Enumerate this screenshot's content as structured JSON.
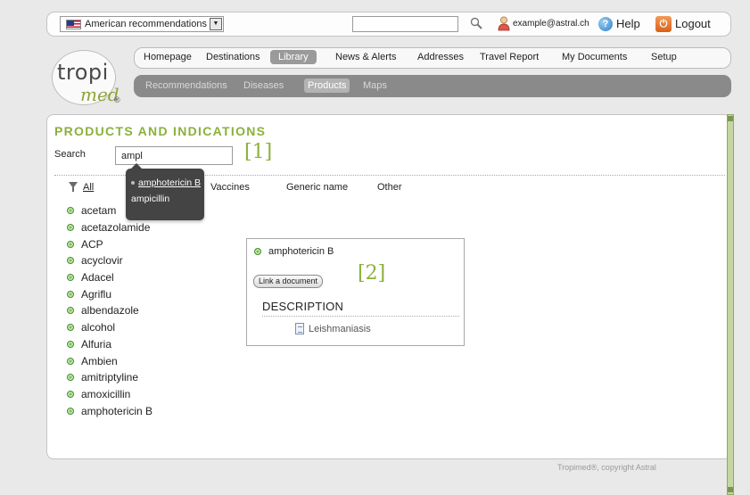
{
  "topbar": {
    "country": "American recommendations",
    "user_email": "example@astral.ch",
    "help_label": "Help",
    "logout_label": "Logout"
  },
  "logo": {
    "part1": "tropi",
    "part2": "med",
    "mark": "®"
  },
  "nav": {
    "main": [
      "Homepage",
      "Destinations",
      "Library",
      "News & Alerts",
      "Addresses",
      "Travel Report",
      "My Documents",
      "Setup"
    ],
    "main_active": "Library",
    "sub": [
      "Recommendations",
      "Diseases",
      "Products",
      "Maps"
    ],
    "sub_active": "Products"
  },
  "panel": {
    "title": "PRODUCTS AND INDICATIONS",
    "search_label": "Search",
    "search_value": "ampl",
    "annotation_1": "[1]",
    "annotation_2": "[2]"
  },
  "filters": [
    "All",
    "Vaccines",
    "Generic name",
    "Other"
  ],
  "suggestions": [
    "amphotericin B",
    "ampicillin"
  ],
  "products": [
    "acetam",
    "acetazolamide",
    "ACP",
    "acyclovir",
    "Adacel",
    "Agriflu",
    "albendazole",
    "alcohol",
    "Alfuria",
    "Ambien",
    "amitriptyline",
    "amoxicillin",
    "amphotericin B"
  ],
  "detail": {
    "name": "amphotericin B",
    "link_button": "Link a document",
    "description_heading": "DESCRIPTION",
    "documents": [
      "Leishmaniasis"
    ]
  },
  "footer": "Tropimed®, copyright Astral",
  "colors": {
    "accent": "#8ab13a",
    "nav_sub_bg": "#8a8a8a",
    "dropdown_bg": "#444444"
  }
}
